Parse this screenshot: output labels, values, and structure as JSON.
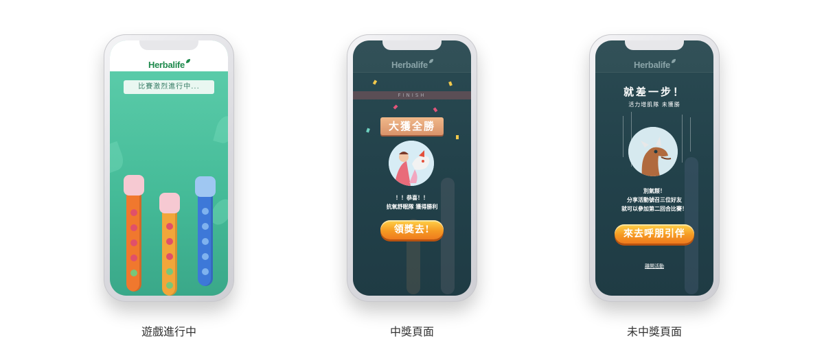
{
  "brand": {
    "name": "Herbalife",
    "color": "#1e8a4c"
  },
  "screens": [
    {
      "id": "playing",
      "caption": "遊戲進行中",
      "banner": "比賽激烈進行中...",
      "background": "#4ec4a1",
      "boats": [
        {
          "color": "#f0782e",
          "head": "#f6c9d2"
        },
        {
          "color": "#f2a63a",
          "head": "#f6c9d2"
        },
        {
          "color": "#3d78d8",
          "head": "#9fc7f2"
        }
      ]
    },
    {
      "id": "win",
      "caption": "中獎頁面",
      "finish": "FINISH",
      "ribbon": "大獲全勝",
      "message_line1": "！！恭喜！！",
      "message_line2": "抗氧舒眠隊 獲得勝利",
      "cta": "領獎去!"
    },
    {
      "id": "lose",
      "caption": "未中獎頁面",
      "title": "就差一步！",
      "subtitle": "活力增肌隊 未獲勝",
      "message_line1": "別氣餒！",
      "message_line2": "分享活動號召三位好友",
      "message_line3": "就可以參加第二回合比賽！",
      "cta": "來去呼朋引伴",
      "leave": "離開活動"
    }
  ],
  "colors": {
    "dark_bg": "#22414a",
    "accent_orange": "#f59a23"
  }
}
